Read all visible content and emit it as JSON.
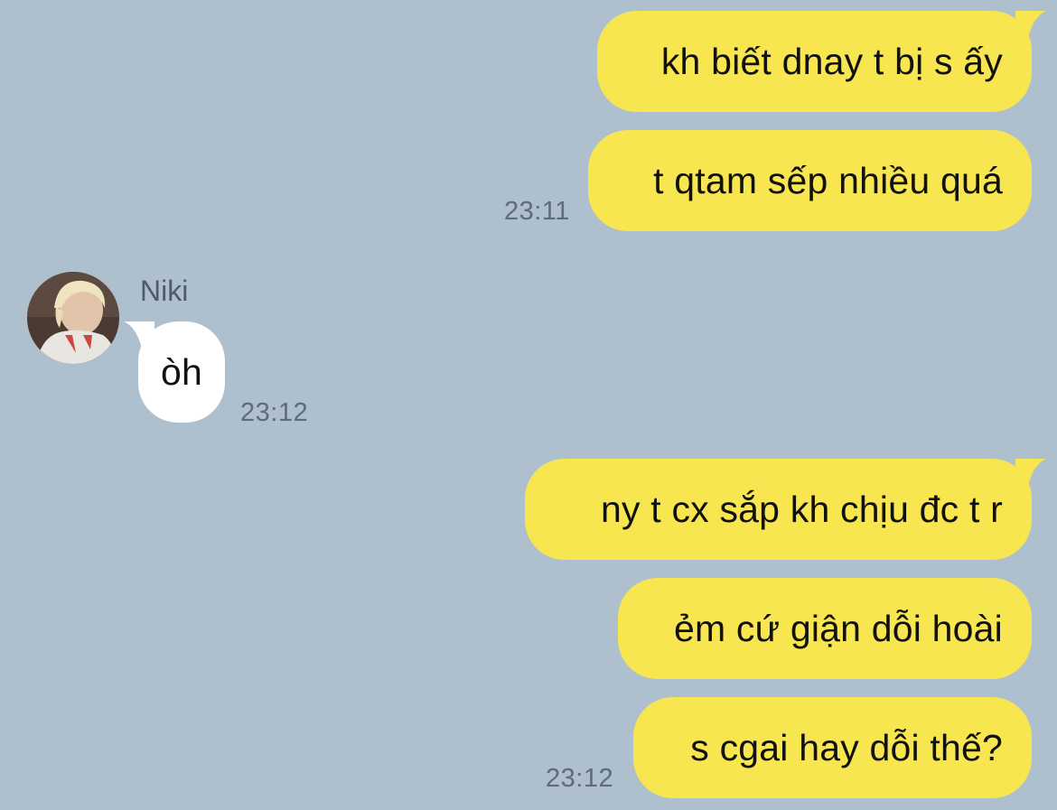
{
  "conversation": {
    "messages": [
      {
        "direction": "out",
        "text": "kh biết dnay t bị s ấy"
      },
      {
        "direction": "out",
        "text": "t qtam sếp nhiều quá",
        "time": "23:11"
      },
      {
        "direction": "in",
        "sender": "Niki",
        "text": "òh",
        "time": "23:12"
      },
      {
        "direction": "out",
        "text": "ny t cx sắp kh chịu đc t r"
      },
      {
        "direction": "out",
        "text": "ẻm cứ giận dỗi hoài"
      },
      {
        "direction": "out",
        "text": "s cgai hay dỗi thế?",
        "time": "23:12"
      }
    ]
  },
  "colors": {
    "background": "#aebfce",
    "outgoing_bubble": "#f8e650",
    "incoming_bubble": "#ffffff",
    "timestamp_text": "#5f6b78"
  },
  "icons": {
    "avatar": "profile-photo-blond-person"
  }
}
